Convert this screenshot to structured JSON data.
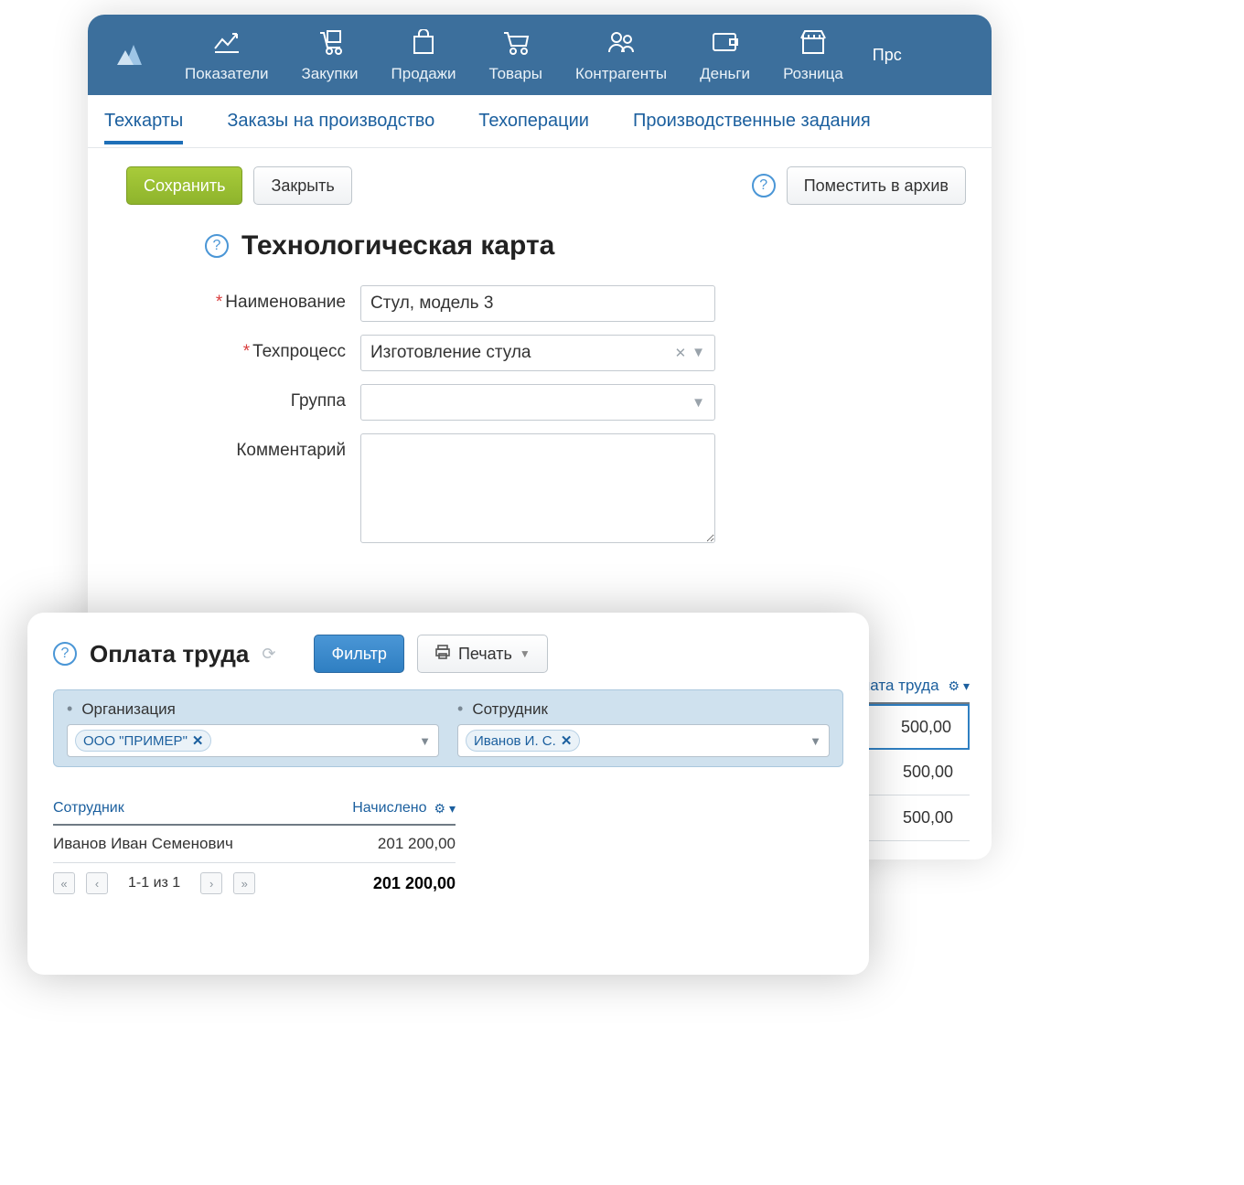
{
  "topnav": {
    "items": [
      {
        "label": "Показатели"
      },
      {
        "label": "Закупки"
      },
      {
        "label": "Продажи"
      },
      {
        "label": "Товары"
      },
      {
        "label": "Контрагенты"
      },
      {
        "label": "Деньги"
      },
      {
        "label": "Розница"
      }
    ],
    "cut": "Прс"
  },
  "subnav": {
    "items": [
      {
        "label": "Техкарты",
        "active": true
      },
      {
        "label": "Заказы на производство"
      },
      {
        "label": "Техоперации"
      },
      {
        "label": "Производственные задания"
      }
    ]
  },
  "toolbar": {
    "save": "Сохранить",
    "close": "Закрыть",
    "archive": "Поместить в архив"
  },
  "page": {
    "title": "Технологическая карта",
    "fields": {
      "name_label": "Наименование",
      "name_value": "Стул, модель 3",
      "process_label": "Техпроцесс",
      "process_value": "Изготовление стула",
      "group_label": "Группа",
      "group_value": "",
      "comment_label": "Комментарий",
      "comment_value": ""
    }
  },
  "pay_column": {
    "header": "лата труда",
    "values": [
      "500,00",
      "500,00",
      "500,00"
    ]
  },
  "pay_window": {
    "title": "Оплата труда",
    "filter_btn": "Фильтр",
    "print_btn": "Печать",
    "filters": {
      "org_label": "Организация",
      "org_chip": "ООО \"ПРИМЕР\"",
      "emp_label": "Сотрудник",
      "emp_chip": "Иванов И. С."
    },
    "table": {
      "col_emp": "Сотрудник",
      "col_sum": "Начислено",
      "rows": [
        {
          "emp": "Иванов Иван Семенович",
          "sum": "201 200,00"
        }
      ],
      "pager": "1-1 из 1",
      "total": "201 200,00"
    }
  }
}
